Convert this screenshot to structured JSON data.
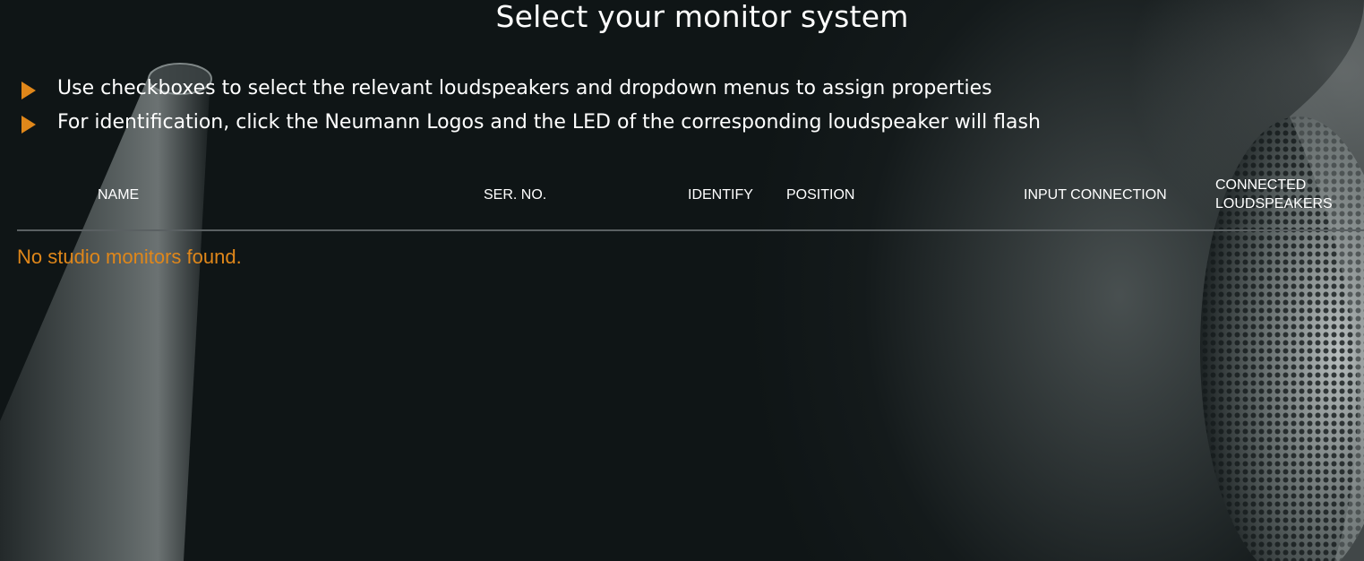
{
  "page": {
    "title": "Select your monitor system"
  },
  "instructions": [
    {
      "icon": "orange-triangle-arrow-icon",
      "text": "Use checkboxes to select the relevant loudspeakers and dropdown menus to assign properties"
    },
    {
      "icon": "orange-triangle-arrow-icon",
      "text": "For identification, click the Neumann Logos and the LED of the corresponding loudspeaker will flash"
    }
  ],
  "table": {
    "columns": {
      "name": "NAME",
      "serial": "SER. NO.",
      "identify": "IDENTIFY",
      "position": "POSITION",
      "input": "INPUT CONNECTION",
      "connected_line1": "CONNECTED",
      "connected_line2": "LOUDSPEAKERS"
    },
    "empty_message": "No studio monitors found."
  },
  "colors": {
    "accent": "#e0871a",
    "background": "#0f1516",
    "text": "#ffffff",
    "divider": "#5a6062"
  }
}
